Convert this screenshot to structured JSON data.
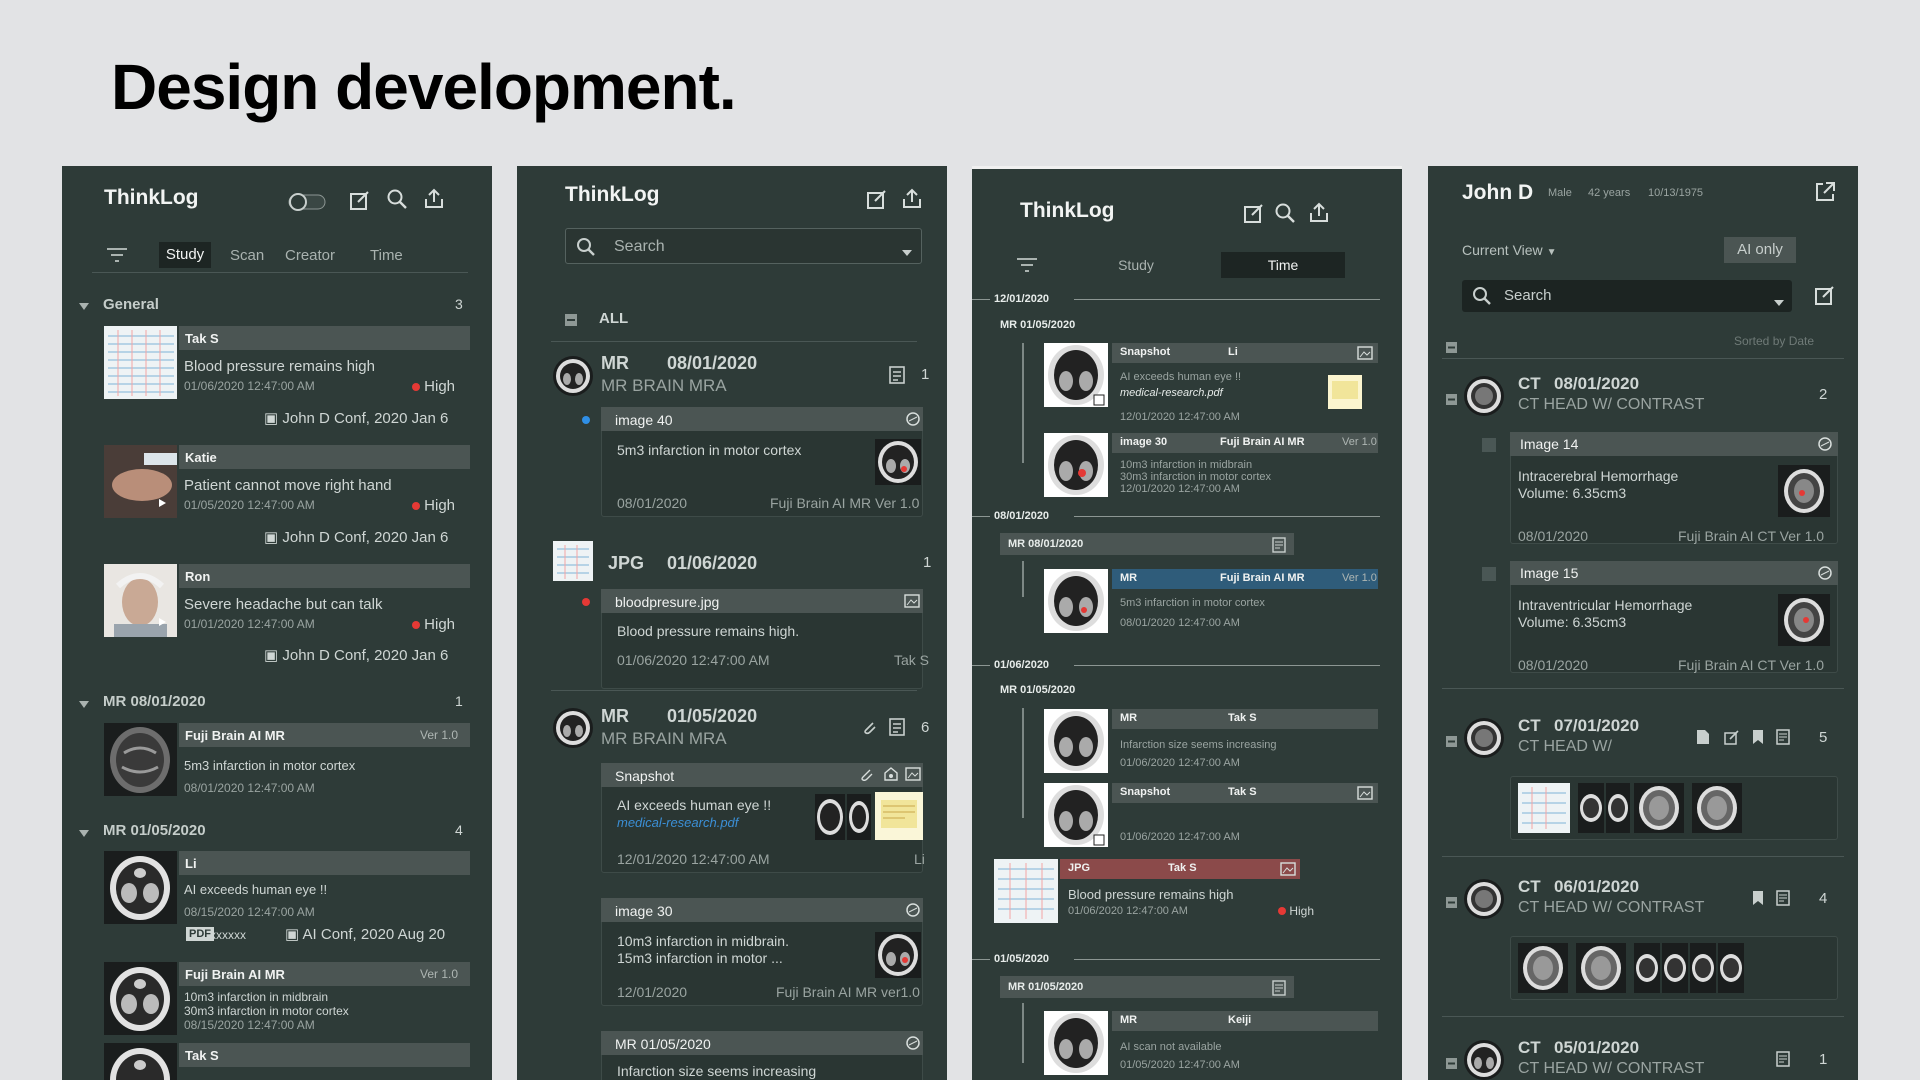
{
  "heading": "Design development.",
  "p1": {
    "title": "ThinkLog",
    "tabs": [
      "Study",
      "Scan",
      "Creator",
      "Time"
    ],
    "general": {
      "label": "General",
      "count": "3"
    },
    "entries": [
      {
        "name": "Tak S",
        "text": "Blood pressure remains high",
        "time": "01/06/2020 12:47:00 AM",
        "priority": "High",
        "conf": "John D Conf, 2020 Jan 6"
      },
      {
        "name": "Katie",
        "text": "Patient cannot move right hand",
        "time": "01/05/2020 12:47:00 AM",
        "priority": "High",
        "conf": "John D Conf, 2020 Jan 6"
      },
      {
        "name": "Ron",
        "text": "Severe headache but can talk",
        "time": "01/01/2020 12:47:00 AM",
        "priority": "High",
        "conf": "John D Conf, 2020 Jan 6"
      }
    ],
    "mr1": {
      "label": "MR 08/01/2020",
      "count": "1",
      "name": "Fuji Brain AI MR",
      "ver": "Ver 1.0",
      "text": "5m3 infarction in motor cortex",
      "time": "08/01/2020 12:47:00 AM"
    },
    "mr2": {
      "label": "MR 01/05/2020",
      "count": "4",
      "e1": {
        "name": "Li",
        "text": "AI exceeds human eye !!",
        "time": "08/15/2020 12:47:00 AM",
        "pdf": "PDF",
        "file": "xxxxxx",
        "conf": "AI Conf, 2020 Aug 20"
      },
      "e2": {
        "name": "Fuji Brain AI MR",
        "ver": "Ver 1.0",
        "l1": "10m3 infarction in midbrain",
        "l2": "30m3 infarction in motor cortex",
        "time": "08/15/2020 12:47:00 AM"
      },
      "e3": {
        "name": "Tak S"
      }
    }
  },
  "p2": {
    "title": "ThinkLog",
    "search_placeholder": "Search",
    "all_label": "ALL",
    "g1": {
      "mod": "MR",
      "date": "08/01/2020",
      "desc": "MR BRAIN MRA",
      "count": "1",
      "card": {
        "head": "image 40",
        "text": "5m3 infarction in motor cortex",
        "date": "08/01/2020",
        "source": "Fuji Brain AI MR Ver 1.0"
      }
    },
    "g2": {
      "mod": "JPG",
      "date": "01/06/2020",
      "count": "1",
      "card": {
        "head": "bloodpresure.jpg",
        "text": "Blood pressure remains high.",
        "date": "01/06/2020 12:47:00 AM",
        "author": "Tak S"
      }
    },
    "g3": {
      "mod": "MR",
      "date": "01/05/2020",
      "desc": "MR BRAIN MRA",
      "count": "6",
      "snap": {
        "head": "Snapshot",
        "text": "AI exceeds human eye !!",
        "link": "medical-research.pdf",
        "date": "12/01/2020  12:47:00 AM",
        "author": "Li"
      },
      "img30": {
        "head": "image 30",
        "l1": "10m3 infarction in midbrain.",
        "l2": "15m3 infarction in motor ...",
        "date": "12/01/2020",
        "source": "Fuji Brain AI MR ver1.0"
      },
      "mr": {
        "head": "MR 01/05/2020",
        "text": "Infarction size seems increasing"
      }
    }
  },
  "p3": {
    "title": "ThinkLog",
    "tabs": [
      "Study",
      "Time"
    ],
    "d1": "12/01/2020",
    "d1_sub": "MR 01/05/2020",
    "snap": {
      "head": "Snapshot",
      "author": "Li",
      "text": "AI exceeds human eye !!",
      "link": "medical-research.pdf",
      "time": "12/01/2020  12:47:00 AM"
    },
    "img30": {
      "head": "image 30",
      "source": "Fuji Brain AI MR",
      "ver": "Ver 1.0",
      "l1": "10m3 infarction in midbrain",
      "l2": "30m3 infarction in motor cortex",
      "time": "12/01/2020  12:47:00 AM"
    },
    "d2": "08/01/2020",
    "d2_bar": "MR 08/01/2020",
    "mr1": {
      "head": "MR",
      "source": "Fuji Brain AI MR",
      "ver": "Ver 1.0",
      "text": "5m3 infarction in motor cortex",
      "time": "08/01/2020  12:47:00 AM"
    },
    "d3": "01/06/2020",
    "d3_sub": "MR 01/05/2020",
    "mr2": {
      "head": "MR",
      "author": "Tak S",
      "text": "Infarction size seems increasing",
      "time": "01/06/2020  12:47:00 AM"
    },
    "snap2": {
      "head": "Snapshot",
      "author": "Tak S",
      "time": "01/06/2020  12:47:00 AM"
    },
    "jpg": {
      "head": "JPG",
      "author": "Tak S",
      "text": "Blood pressure remains high",
      "time": "01/06/2020  12:47:00 AM",
      "priority": "High"
    },
    "d4": "01/05/2020",
    "d4_bar": "MR 01/05/2020",
    "mr3": {
      "head": "MR",
      "author": "Keiji",
      "text": "AI scan not available",
      "time": "01/05/2020  12:47:00 AM"
    }
  },
  "p4": {
    "patient": "John D",
    "sex": "Male",
    "age": "42 years",
    "dob": "10/13/1975",
    "view": "Current View",
    "ai_only": "AI only",
    "search_placeholder": "Search",
    "sorted": "Sorted by Date",
    "s1": {
      "mod": "CT",
      "date": "08/01/2020",
      "desc": "CT HEAD W/ CONTRAST",
      "count": "2",
      "i14": {
        "head": "Image 14",
        "l1": "Intracerebral Hemorrhage",
        "l2": "Volume: 6.35cm3",
        "date": "08/01/2020",
        "source": "Fuji Brain AI CT Ver 1.0"
      },
      "i15": {
        "head": "Image 15",
        "l1": "Intraventricular Hemorrhage",
        "l2": "Volume: 6.35cm3",
        "date": "08/01/2020",
        "source": "Fuji Brain AI CT Ver 1.0"
      }
    },
    "s2": {
      "mod": "CT",
      "date": "07/01/2020",
      "desc": "CT HEAD W/",
      "count": "5"
    },
    "s3": {
      "mod": "CT",
      "date": "06/01/2020",
      "desc": "CT HEAD W/ CONTRAST",
      "count": "4"
    },
    "s4": {
      "mod": "CT",
      "date": "05/01/2020",
      "desc": "CT HEAD W/ CONTRAST",
      "count": "1"
    }
  }
}
